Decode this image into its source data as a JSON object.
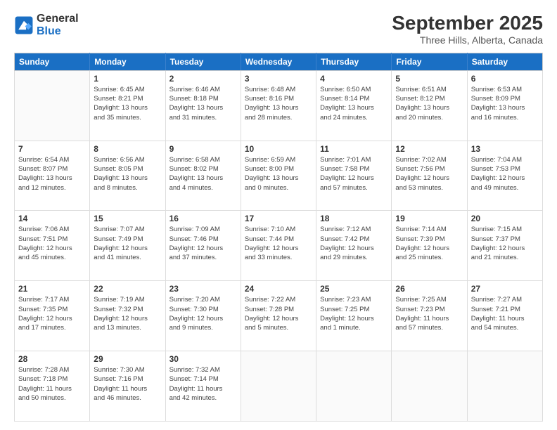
{
  "logo": {
    "line1": "General",
    "line2": "Blue"
  },
  "title": "September 2025",
  "subtitle": "Three Hills, Alberta, Canada",
  "days_header": [
    "Sunday",
    "Monday",
    "Tuesday",
    "Wednesday",
    "Thursday",
    "Friday",
    "Saturday"
  ],
  "weeks": [
    [
      {
        "num": "",
        "info": ""
      },
      {
        "num": "1",
        "info": "Sunrise: 6:45 AM\nSunset: 8:21 PM\nDaylight: 13 hours\nand 35 minutes."
      },
      {
        "num": "2",
        "info": "Sunrise: 6:46 AM\nSunset: 8:18 PM\nDaylight: 13 hours\nand 31 minutes."
      },
      {
        "num": "3",
        "info": "Sunrise: 6:48 AM\nSunset: 8:16 PM\nDaylight: 13 hours\nand 28 minutes."
      },
      {
        "num": "4",
        "info": "Sunrise: 6:50 AM\nSunset: 8:14 PM\nDaylight: 13 hours\nand 24 minutes."
      },
      {
        "num": "5",
        "info": "Sunrise: 6:51 AM\nSunset: 8:12 PM\nDaylight: 13 hours\nand 20 minutes."
      },
      {
        "num": "6",
        "info": "Sunrise: 6:53 AM\nSunset: 8:09 PM\nDaylight: 13 hours\nand 16 minutes."
      }
    ],
    [
      {
        "num": "7",
        "info": "Sunrise: 6:54 AM\nSunset: 8:07 PM\nDaylight: 13 hours\nand 12 minutes."
      },
      {
        "num": "8",
        "info": "Sunrise: 6:56 AM\nSunset: 8:05 PM\nDaylight: 13 hours\nand 8 minutes."
      },
      {
        "num": "9",
        "info": "Sunrise: 6:58 AM\nSunset: 8:02 PM\nDaylight: 13 hours\nand 4 minutes."
      },
      {
        "num": "10",
        "info": "Sunrise: 6:59 AM\nSunset: 8:00 PM\nDaylight: 13 hours\nand 0 minutes."
      },
      {
        "num": "11",
        "info": "Sunrise: 7:01 AM\nSunset: 7:58 PM\nDaylight: 12 hours\nand 57 minutes."
      },
      {
        "num": "12",
        "info": "Sunrise: 7:02 AM\nSunset: 7:56 PM\nDaylight: 12 hours\nand 53 minutes."
      },
      {
        "num": "13",
        "info": "Sunrise: 7:04 AM\nSunset: 7:53 PM\nDaylight: 12 hours\nand 49 minutes."
      }
    ],
    [
      {
        "num": "14",
        "info": "Sunrise: 7:06 AM\nSunset: 7:51 PM\nDaylight: 12 hours\nand 45 minutes."
      },
      {
        "num": "15",
        "info": "Sunrise: 7:07 AM\nSunset: 7:49 PM\nDaylight: 12 hours\nand 41 minutes."
      },
      {
        "num": "16",
        "info": "Sunrise: 7:09 AM\nSunset: 7:46 PM\nDaylight: 12 hours\nand 37 minutes."
      },
      {
        "num": "17",
        "info": "Sunrise: 7:10 AM\nSunset: 7:44 PM\nDaylight: 12 hours\nand 33 minutes."
      },
      {
        "num": "18",
        "info": "Sunrise: 7:12 AM\nSunset: 7:42 PM\nDaylight: 12 hours\nand 29 minutes."
      },
      {
        "num": "19",
        "info": "Sunrise: 7:14 AM\nSunset: 7:39 PM\nDaylight: 12 hours\nand 25 minutes."
      },
      {
        "num": "20",
        "info": "Sunrise: 7:15 AM\nSunset: 7:37 PM\nDaylight: 12 hours\nand 21 minutes."
      }
    ],
    [
      {
        "num": "21",
        "info": "Sunrise: 7:17 AM\nSunset: 7:35 PM\nDaylight: 12 hours\nand 17 minutes."
      },
      {
        "num": "22",
        "info": "Sunrise: 7:19 AM\nSunset: 7:32 PM\nDaylight: 12 hours\nand 13 minutes."
      },
      {
        "num": "23",
        "info": "Sunrise: 7:20 AM\nSunset: 7:30 PM\nDaylight: 12 hours\nand 9 minutes."
      },
      {
        "num": "24",
        "info": "Sunrise: 7:22 AM\nSunset: 7:28 PM\nDaylight: 12 hours\nand 5 minutes."
      },
      {
        "num": "25",
        "info": "Sunrise: 7:23 AM\nSunset: 7:25 PM\nDaylight: 12 hours\nand 1 minute."
      },
      {
        "num": "26",
        "info": "Sunrise: 7:25 AM\nSunset: 7:23 PM\nDaylight: 11 hours\nand 57 minutes."
      },
      {
        "num": "27",
        "info": "Sunrise: 7:27 AM\nSunset: 7:21 PM\nDaylight: 11 hours\nand 54 minutes."
      }
    ],
    [
      {
        "num": "28",
        "info": "Sunrise: 7:28 AM\nSunset: 7:18 PM\nDaylight: 11 hours\nand 50 minutes."
      },
      {
        "num": "29",
        "info": "Sunrise: 7:30 AM\nSunset: 7:16 PM\nDaylight: 11 hours\nand 46 minutes."
      },
      {
        "num": "30",
        "info": "Sunrise: 7:32 AM\nSunset: 7:14 PM\nDaylight: 11 hours\nand 42 minutes."
      },
      {
        "num": "",
        "info": ""
      },
      {
        "num": "",
        "info": ""
      },
      {
        "num": "",
        "info": ""
      },
      {
        "num": "",
        "info": ""
      }
    ]
  ]
}
